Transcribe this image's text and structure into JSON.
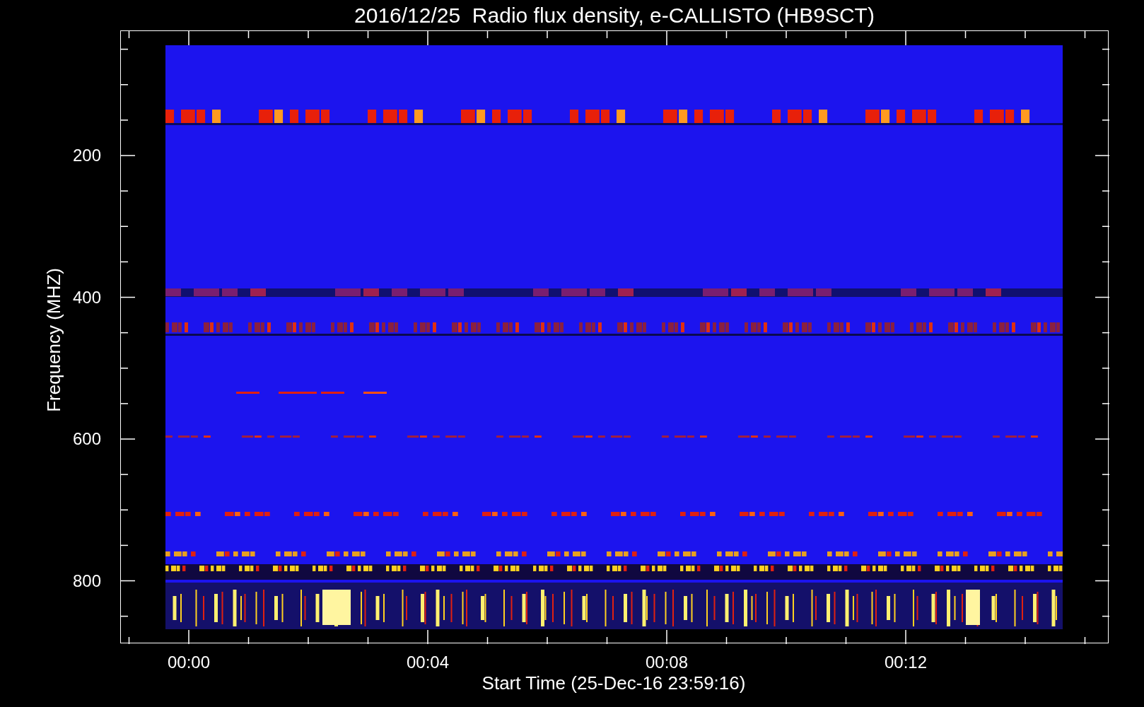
{
  "title": "2016/12/25  Radio flux density, e-CALLISTO (HB9SCT)",
  "chart": {
    "ylabel": "Frequency (MHZ)",
    "xlabel": "Start Time (25-Dec-16 23:59:16)",
    "yticks": [
      "200",
      "400",
      "600",
      "800"
    ],
    "xticks": [
      "00:00",
      "00:04",
      "00:08",
      "00:12"
    ]
  }
}
